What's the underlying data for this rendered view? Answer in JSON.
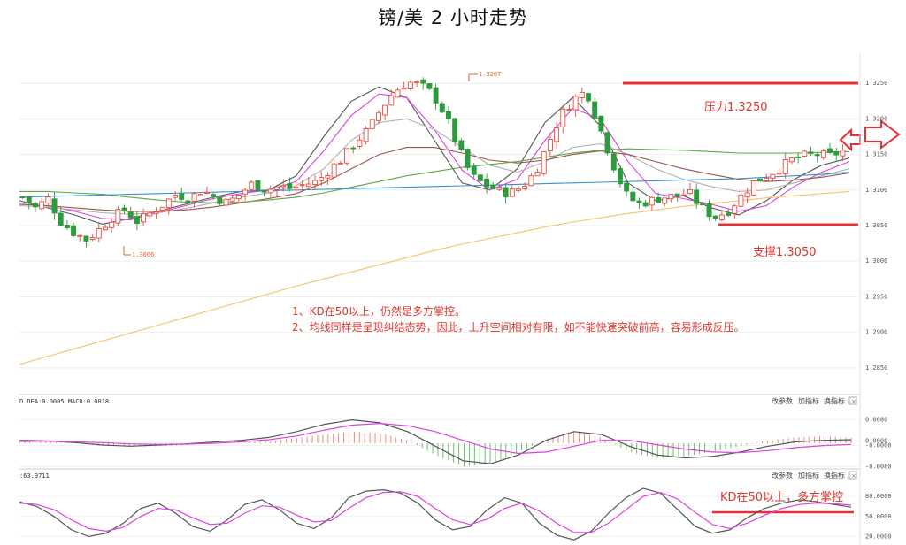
{
  "title": "镑/美  2 小时走势",
  "annotations": {
    "resistance_label": "压力1.3250",
    "support_label": "支撑1.3050",
    "note_line1": "1、KD在50以上，仍然是多方掌控。",
    "note_line2": "2、均线同样是呈现纠结态势，因此，上升空间相对有限，如不能快速突破前高，容易形成反压。",
    "kd_note": "KD在50以上，多方掌控",
    "high_marker": "1.3267",
    "low_marker": "1.3006"
  },
  "toolbar": {
    "macd_buttons": [
      "改参数",
      "加指标",
      "换指标"
    ],
    "kd_buttons": [
      "改参数",
      "加指标",
      "换指标"
    ]
  },
  "indicator_labels": {
    "macd": "D DEA:0.0005 MACD:0.0018",
    "kd": ":63.9711"
  },
  "colors": {
    "up_candle": "#e84c3d",
    "down_candle": "#2e9a3e",
    "resistance_line": "#e83030",
    "arrow": "#e83030",
    "ma_black": "#555555",
    "ma_magenta": "#e040e0",
    "ma_gray": "#b0b0b0",
    "ma_brown": "#a0524d",
    "ma_green": "#5aaa44",
    "ma_blue": "#3a8fd0",
    "ma_orange": "#f6c26b"
  },
  "chart_data": [
    {
      "type": "candlestick",
      "title": "镑/美  2 小时走势",
      "y_axis_ticks": [
        "1.3250",
        "1.3200",
        "1.3150",
        "1.3100",
        "1.3050",
        "1.3000",
        "1.2950",
        "1.2900",
        "1.2850"
      ],
      "ylim": [
        1.282,
        1.329
      ],
      "resistance": 1.325,
      "support": 1.305,
      "period_high": 1.3267,
      "period_low": 1.3006,
      "close_path": [
        1.309,
        1.3075,
        1.3088,
        1.3055,
        1.304,
        1.303,
        1.3045,
        1.3062,
        1.3072,
        1.3055,
        1.3068,
        1.308,
        1.3095,
        1.3088,
        1.31,
        1.309,
        1.3082,
        1.3095,
        1.311,
        1.31,
        1.3105,
        1.3102,
        1.3108,
        1.3112,
        1.313,
        1.3145,
        1.3168,
        1.3185,
        1.3215,
        1.3238,
        1.3252,
        1.3248,
        1.3235,
        1.3205,
        1.316,
        1.312,
        1.3108,
        1.31,
        1.3095,
        1.3105,
        1.3125,
        1.3165,
        1.3205,
        1.3228,
        1.324,
        1.319,
        1.314,
        1.3095,
        1.308,
        1.3085,
        1.309,
        1.3092,
        1.3096,
        1.3075,
        1.3062,
        1.307,
        1.309,
        1.311,
        1.312,
        1.313,
        1.3142,
        1.3148,
        1.315,
        1.3148,
        1.3155
      ],
      "moving_averages": [
        {
          "color": "#555555",
          "values": [
            1.3085,
            1.3075,
            1.3065,
            1.3052,
            1.306,
            1.307,
            1.308,
            1.309,
            1.3098,
            1.31,
            1.312,
            1.3175,
            1.3225,
            1.3245,
            1.323,
            1.317,
            1.311,
            1.31,
            1.313,
            1.3195,
            1.323,
            1.319,
            1.311,
            1.3085,
            1.3092,
            1.3075,
            1.3065,
            1.3085,
            1.3115,
            1.3135,
            1.3145
          ]
        },
        {
          "color": "#e040e0",
          "values": [
            1.308,
            1.3078,
            1.307,
            1.306,
            1.3058,
            1.3068,
            1.3078,
            1.3088,
            1.3095,
            1.31,
            1.3112,
            1.3155,
            1.3205,
            1.3235,
            1.323,
            1.3185,
            1.3128,
            1.31,
            1.3115,
            1.317,
            1.3215,
            1.32,
            1.314,
            1.3095,
            1.3088,
            1.308,
            1.307,
            1.3078,
            1.3105,
            1.3125,
            1.314
          ]
        },
        {
          "color": "#b0b0b0",
          "values": [
            1.3078,
            1.3076,
            1.3072,
            1.3068,
            1.3066,
            1.3068,
            1.3074,
            1.3082,
            1.309,
            1.3096,
            1.3106,
            1.313,
            1.317,
            1.3195,
            1.32,
            1.3185,
            1.316,
            1.3135,
            1.3125,
            1.314,
            1.316,
            1.3165,
            1.315,
            1.313,
            1.3115,
            1.3105,
            1.3098,
            1.31,
            1.311,
            1.312,
            1.313
          ]
        },
        {
          "color": "#a0524d",
          "values": [
            1.308,
            1.3078,
            1.3075,
            1.3072,
            1.307,
            1.307,
            1.3072,
            1.3076,
            1.3082,
            1.3088,
            1.3095,
            1.311,
            1.313,
            1.315,
            1.316,
            1.316,
            1.3152,
            1.3142,
            1.3138,
            1.3142,
            1.315,
            1.3155,
            1.315,
            1.314,
            1.313,
            1.3122,
            1.3115,
            1.3112,
            1.3114,
            1.3118,
            1.3124
          ]
        },
        {
          "color": "#5aaa44",
          "values": [
            1.3098,
            1.3098,
            1.3096,
            1.3094,
            1.309,
            1.3086,
            1.3083,
            1.3082,
            1.3083,
            1.3086,
            1.309,
            1.3096,
            1.3104,
            1.3112,
            1.312,
            1.3126,
            1.3132,
            1.3136,
            1.314,
            1.3146,
            1.3152,
            1.3156,
            1.3158,
            1.3157,
            1.3156,
            1.3154,
            1.3152,
            1.3152,
            1.3152,
            1.3153,
            1.3154
          ]
        },
        {
          "color": "#3a8fd0",
          "values": [
            1.309,
            1.3091,
            1.3092,
            1.3093,
            1.3094,
            1.3095,
            1.3096,
            1.3097,
            1.3098,
            1.3099,
            1.31,
            1.3101,
            1.3102,
            1.3103,
            1.3104,
            1.3105,
            1.3106,
            1.3107,
            1.3108,
            1.3109,
            1.311,
            1.3111,
            1.3112,
            1.3113,
            1.3114,
            1.3115,
            1.3116,
            1.3118,
            1.312,
            1.3122,
            1.3125
          ]
        },
        {
          "color": "#f6c26b",
          "values": [
            1.2855,
            1.2866,
            1.2877,
            1.2888,
            1.2899,
            1.291,
            1.2921,
            1.2932,
            1.2943,
            1.2954,
            1.2965,
            1.2975,
            1.2985,
            1.2995,
            1.3005,
            1.3015,
            1.3024,
            1.3032,
            1.304,
            1.3048,
            1.3055,
            1.3061,
            1.3067,
            1.3072,
            1.3077,
            1.3081,
            1.3085,
            1.3089,
            1.3092,
            1.3095,
            1.3098
          ]
        }
      ]
    },
    {
      "type": "macd",
      "y_axis_ticks": [
        "0.0080",
        "0.0000",
        "-0.0000",
        "-0.0080"
      ],
      "histogram": [
        0.001,
        0.0005,
        0.0,
        -0.0008,
        -0.0012,
        -0.001,
        -0.0006,
        0.0,
        0.0004,
        0.0008,
        0.0018,
        0.003,
        0.004,
        0.0035,
        0.001,
        -0.004,
        -0.008,
        -0.007,
        -0.003,
        0.0015,
        0.004,
        0.002,
        -0.003,
        -0.005,
        -0.0045,
        -0.003,
        -0.001,
        0.001,
        0.002,
        0.0025,
        0.0018
      ],
      "dif": [
        0.001,
        0.0008,
        0.0002,
        -0.0006,
        -0.001,
        -0.0006,
        -0.0002,
        0.0004,
        0.001,
        0.002,
        0.004,
        0.0065,
        0.008,
        0.007,
        0.004,
        -0.001,
        -0.006,
        -0.007,
        -0.004,
        0.001,
        0.004,
        0.003,
        -0.001,
        -0.004,
        -0.005,
        -0.0045,
        -0.003,
        -0.001,
        0.0005,
        0.001,
        0.0012
      ],
      "dea": [
        0.0006,
        0.0007,
        0.0005,
        0.0002,
        -0.0002,
        -0.0004,
        -0.0003,
        0.0,
        0.0005,
        0.0012,
        0.0025,
        0.0045,
        0.0062,
        0.0068,
        0.006,
        0.004,
        0.001,
        -0.002,
        -0.0035,
        -0.003,
        -0.001,
        0.001,
        0.001,
        -0.0005,
        -0.002,
        -0.003,
        -0.0032,
        -0.0025,
        -0.0015,
        -0.0008,
        -0.0004
      ]
    },
    {
      "type": "kd",
      "y_axis_ticks": [
        "80.0000",
        "50.0000",
        "20.0000"
      ],
      "ylim": [
        10,
        100
      ],
      "k": [
        72,
        65,
        50,
        30,
        20,
        25,
        40,
        62,
        70,
        55,
        35,
        28,
        45,
        68,
        75,
        60,
        40,
        32,
        48,
        78,
        88,
        90,
        85,
        70,
        45,
        30,
        35,
        60,
        78,
        70,
        40,
        22,
        15,
        28,
        55,
        78,
        92,
        85,
        60,
        35,
        25,
        30,
        48,
        62,
        70,
        75,
        72,
        68,
        64
      ],
      "d": [
        70,
        68,
        60,
        45,
        32,
        28,
        34,
        50,
        62,
        60,
        48,
        38,
        40,
        55,
        66,
        64,
        52,
        42,
        44,
        62,
        78,
        86,
        87,
        80,
        62,
        45,
        38,
        46,
        62,
        70,
        58,
        40,
        26,
        26,
        40,
        60,
        80,
        86,
        76,
        56,
        38,
        32,
        40,
        52,
        62,
        68,
        70,
        69,
        67
      ],
      "reference_level": 50
    }
  ]
}
